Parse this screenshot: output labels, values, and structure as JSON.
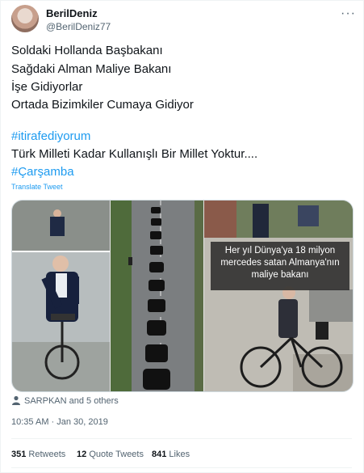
{
  "author": {
    "display_name": "BerilDeniz",
    "handle": "@BerilDeniz77"
  },
  "more_icon": "ellipsis-icon",
  "tweet": {
    "lines": [
      "Soldaki Hollanda Başbakanı",
      "Sağdaki Alman Maliye Bakanı",
      "İşe Gidiyorlar",
      "Ortada Bizimkiler Cumaya Gidiyor"
    ],
    "hashtag1": "#itirafediyorum",
    "line5": "Türk Milleti Kadar Kullanışlı Bir Millet Yoktur....",
    "hashtag2": "#Çarşamba",
    "translate_label": "Translate Tweet"
  },
  "media": {
    "caption_lines": [
      "Her yıl Dünya'ya 18 milyon",
      "mercedes satan Almanya'nın",
      "maliye bakanı"
    ]
  },
  "liked_by": "SARPKAN and 5 others",
  "timestamp": "10:35 AM · Jan 30, 2019",
  "stats": {
    "retweets_count": "351",
    "retweets_label": "Retweets",
    "quotes_count": "12",
    "quotes_label": "Quote Tweets",
    "likes_count": "841",
    "likes_label": "Likes"
  }
}
